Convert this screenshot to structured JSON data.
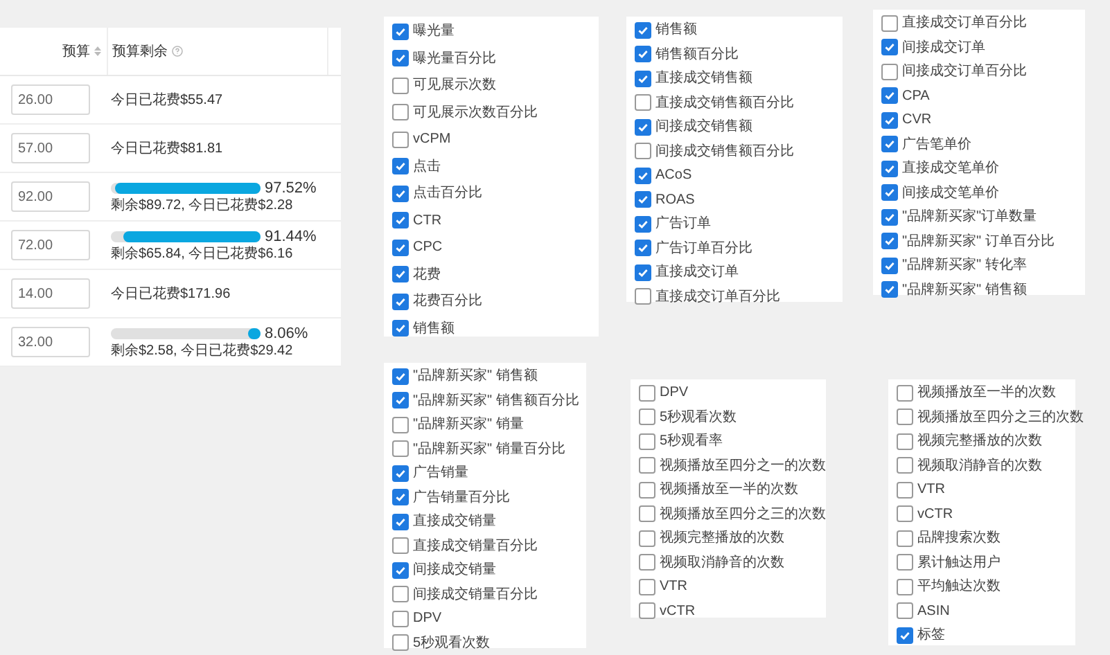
{
  "table": {
    "columns": [
      {
        "label": "预算",
        "sortable": true
      },
      {
        "label": "预算剩余",
        "help": true
      }
    ],
    "rows": [
      {
        "budget": "26.00",
        "kind": "text",
        "note": "今日已花费$55.47"
      },
      {
        "budget": "57.00",
        "kind": "text",
        "note": "今日已花费$81.81"
      },
      {
        "budget": "92.00",
        "kind": "progress",
        "level": 0.9752,
        "percent": "97.52%",
        "note": "剩余$89.72, 今日已花费$2.28"
      },
      {
        "budget": "72.00",
        "kind": "progress",
        "level": 0.9144,
        "percent": "91.44%",
        "note": "剩余$65.84, 今日已花费$6.16"
      },
      {
        "budget": "14.00",
        "kind": "text",
        "note": "今日已花费$171.96"
      },
      {
        "budget": "32.00",
        "kind": "progress",
        "level": 0.0806,
        "percent": "8.06%",
        "note": "剩余$2.58, 今日已花费$29.42"
      }
    ]
  },
  "panels": [
    {
      "items": [
        {
          "label": "曝光量",
          "checked": true
        },
        {
          "label": "曝光量百分比",
          "checked": true
        },
        {
          "label": "可见展示次数",
          "checked": false
        },
        {
          "label": "可见展示次数百分比",
          "checked": false
        },
        {
          "label": "vCPM",
          "checked": false
        },
        {
          "label": "点击",
          "checked": true
        },
        {
          "label": "点击百分比",
          "checked": true
        },
        {
          "label": "CTR",
          "checked": true
        },
        {
          "label": "CPC",
          "checked": true
        },
        {
          "label": "花费",
          "checked": true
        },
        {
          "label": "花费百分比",
          "checked": true
        },
        {
          "label": "销售额",
          "checked": true
        }
      ]
    },
    {
      "items": [
        {
          "label": "销售额",
          "checked": true
        },
        {
          "label": "销售额百分比",
          "checked": true
        },
        {
          "label": "直接成交销售额",
          "checked": true
        },
        {
          "label": "直接成交销售额百分比",
          "checked": false
        },
        {
          "label": "间接成交销售额",
          "checked": true
        },
        {
          "label": "间接成交销售额百分比",
          "checked": false
        },
        {
          "label": "ACoS",
          "checked": true
        },
        {
          "label": "ROAS",
          "checked": true
        },
        {
          "label": "广告订单",
          "checked": true
        },
        {
          "label": "广告订单百分比",
          "checked": true
        },
        {
          "label": "直接成交订单",
          "checked": true
        },
        {
          "label": "直接成交订单百分比",
          "checked": false
        }
      ]
    },
    {
      "items": [
        {
          "label": "直接成交订单百分比",
          "checked": false
        },
        {
          "label": "间接成交订单",
          "checked": true
        },
        {
          "label": "间接成交订单百分比",
          "checked": false
        },
        {
          "label": "CPA",
          "checked": true
        },
        {
          "label": "CVR",
          "checked": true
        },
        {
          "label": "广告笔单价",
          "checked": true
        },
        {
          "label": "直接成交笔单价",
          "checked": true
        },
        {
          "label": "间接成交笔单价",
          "checked": true
        },
        {
          "label": "\"品牌新买家\"订单数量",
          "checked": true
        },
        {
          "label": "\"品牌新买家\" 订单百分比",
          "checked": true
        },
        {
          "label": "\"品牌新买家\" 转化率",
          "checked": true
        },
        {
          "label": "\"品牌新买家\" 销售额",
          "checked": true
        }
      ]
    },
    {
      "items": [
        {
          "label": "\"品牌新买家\" 销售额",
          "checked": true
        },
        {
          "label": "\"品牌新买家\" 销售额百分比",
          "checked": true
        },
        {
          "label": "\"品牌新买家\" 销量",
          "checked": false
        },
        {
          "label": "\"品牌新买家\" 销量百分比",
          "checked": false
        },
        {
          "label": "广告销量",
          "checked": true
        },
        {
          "label": "广告销量百分比",
          "checked": true
        },
        {
          "label": "直接成交销量",
          "checked": true
        },
        {
          "label": "直接成交销量百分比",
          "checked": false
        },
        {
          "label": "间接成交销量",
          "checked": true
        },
        {
          "label": "间接成交销量百分比",
          "checked": false
        },
        {
          "label": "DPV",
          "checked": false
        },
        {
          "label": "5秒观看次数",
          "checked": false
        }
      ]
    },
    {
      "items": [
        {
          "label": "DPV",
          "checked": false
        },
        {
          "label": "5秒观看次数",
          "checked": false
        },
        {
          "label": "5秒观看率",
          "checked": false
        },
        {
          "label": "视频播放至四分之一的次数",
          "checked": false
        },
        {
          "label": "视频播放至一半的次数",
          "checked": false
        },
        {
          "label": "视频播放至四分之三的次数",
          "checked": false
        },
        {
          "label": "视频完整播放的次数",
          "checked": false
        },
        {
          "label": "视频取消静音的次数",
          "checked": false
        },
        {
          "label": "VTR",
          "checked": false
        },
        {
          "label": "vCTR",
          "checked": false
        }
      ]
    },
    {
      "items": [
        {
          "label": "视频播放至一半的次数",
          "checked": false
        },
        {
          "label": "视频播放至四分之三的次数",
          "checked": false
        },
        {
          "label": "视频完整播放的次数",
          "checked": false
        },
        {
          "label": "视频取消静音的次数",
          "checked": false
        },
        {
          "label": "VTR",
          "checked": false
        },
        {
          "label": "vCTR",
          "checked": false
        },
        {
          "label": "品牌搜索次数",
          "checked": false
        },
        {
          "label": "累计触达用户",
          "checked": false
        },
        {
          "label": "平均触达次数",
          "checked": false
        },
        {
          "label": "ASIN",
          "checked": false
        },
        {
          "label": "标签",
          "checked": true
        }
      ]
    }
  ]
}
